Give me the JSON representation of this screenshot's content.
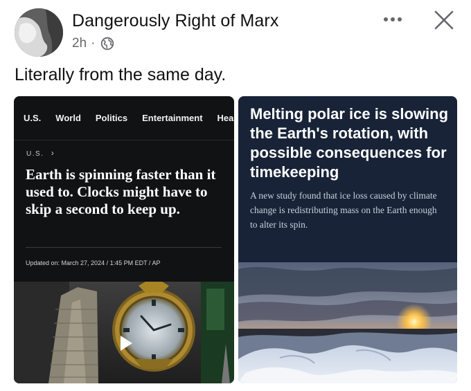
{
  "post": {
    "author": "Dangerously Right of Marx",
    "time": "2h",
    "separator": "·",
    "caption": "Literally from the same day."
  },
  "icons": {
    "avatar": "avatar-image",
    "audience": "globe-icon",
    "more": "more-horizontal-icon",
    "close": "close-icon",
    "play": "play-icon",
    "chevron": "chevron-right-icon"
  },
  "left_card": {
    "nav_items": [
      "U.S.",
      "World",
      "Politics",
      "Entertainment",
      "Heal"
    ],
    "section_label": "U.S.",
    "section_chevron": "›",
    "headline": "Earth is spinning faster than it used to. Clocks might have to skip a second to keep up.",
    "updated": "Updated on: March 27, 2024 / 1:45 PM EDT / AP"
  },
  "right_card": {
    "headline": "Melting polar ice is slowing the Earth's rotation, with possible consequences for timekeeping",
    "dek": "A new study found that ice loss caused by climate change is redistributing mass on the Earth enough to alter its spin."
  },
  "colors": {
    "left_bg": "#111213",
    "right_bg": "#182338",
    "meta_gray": "#65676b"
  }
}
